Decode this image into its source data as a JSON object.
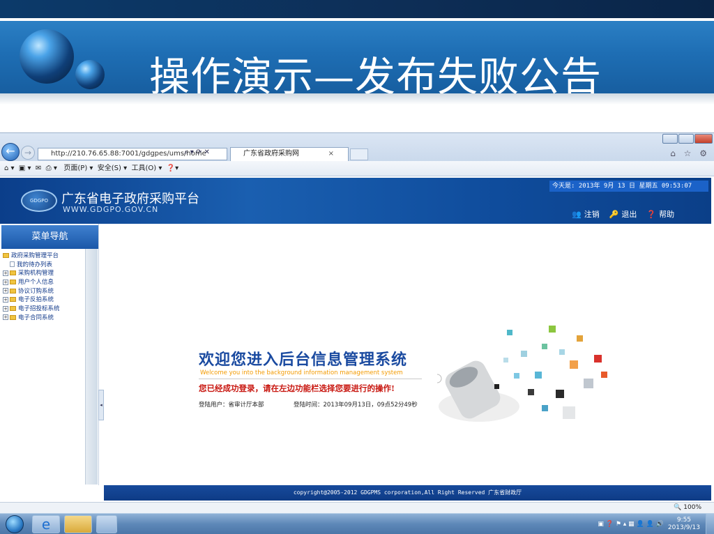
{
  "slide": {
    "title": "操作演示—发布失败公告"
  },
  "browser": {
    "url": "http://210.76.65.88:7001/gdgpes/ums/home",
    "tab_title": "广东省政府采购网",
    "tab_close": "×",
    "address_tools": "⌕ ▾ ⟳ ✕",
    "right_icons": "⌂ ☆ ⚙",
    "command_bar": [
      "页面(P) ▾",
      "安全(S) ▾",
      "工具(O) ▾"
    ],
    "zoom": "🔍 100%"
  },
  "site": {
    "logo_text": "GDGPO",
    "name": "广东省电子政府采购平台",
    "url": "WWW.GDGPO.GOV.CN",
    "date": "今天是: 2013年 9月 13 日 星期五  09:53:07",
    "actions": [
      {
        "label": "注销"
      },
      {
        "label": "退出"
      },
      {
        "label": "帮助"
      }
    ]
  },
  "sidebar": {
    "title": "菜单导航",
    "tree": [
      {
        "label": "政府采购管理平台",
        "kind": "root"
      },
      {
        "label": "我的待办列表",
        "kind": "doc"
      },
      {
        "label": "采购机构管理",
        "kind": "folder"
      },
      {
        "label": "用户个人信息",
        "kind": "folder"
      },
      {
        "label": "协议订购系统",
        "kind": "folder"
      },
      {
        "label": "电子反拍系统",
        "kind": "folder"
      },
      {
        "label": "电子招投标系统",
        "kind": "folder"
      },
      {
        "label": "电子合同系统",
        "kind": "folder"
      }
    ]
  },
  "welcome": {
    "title": "欢迎您进入后台信息管理系统",
    "subtitle": "Welcome you into the background information management system",
    "message": "您已经成功登录，请在左边功能栏选择您要进行的操作!",
    "user": "登陆用户：省审计厅本部",
    "time": "登陆时间：2013年09月13日，09点52分49秒"
  },
  "footer": {
    "copyright": "copyright@2005-2012 GDGPMS corporation,All Right Reserved 广东省财政厅"
  },
  "taskbar": {
    "clock_time": "9:55",
    "clock_date": "2013/9/13"
  }
}
